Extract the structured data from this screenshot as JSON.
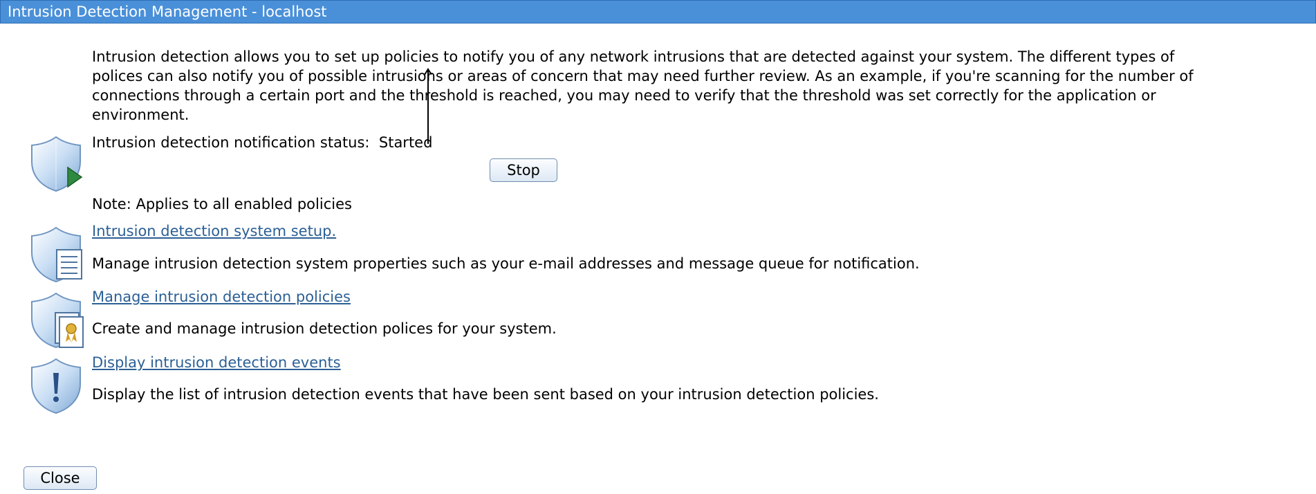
{
  "window": {
    "title": "Intrusion Detection Management - localhost"
  },
  "intro": {
    "lines": [
      "Intrusion detection allows you to set up policies to notify you of any network intrusions that are detected against your system. The different types of",
      "polices can also notify you of possible intrusions or areas of concern that may need further review. As an example, if you're scanning for the number of",
      "connections through a certain port and the threshold is reached, you may need to verify that the threshold was set correctly for the application or",
      "environment."
    ]
  },
  "status": {
    "label": "Intrusion detection notification status:",
    "value": "Started",
    "stop_button": "Stop",
    "note": "Note: Applies to all enabled policies",
    "icon": "shield-play-icon"
  },
  "tasks": [
    {
      "link": "Intrusion detection system setup.",
      "description": "Manage intrusion detection system properties such as your e-mail addresses and message queue for notification.",
      "icon": "shield-list-icon"
    },
    {
      "link": "Manage intrusion detection policies",
      "description": "Create and manage intrusion detection polices for your system.",
      "icon": "shield-certificate-icon"
    },
    {
      "link": "Display intrusion detection events",
      "description": "Display the list of intrusion detection events that have been sent based on your intrusion detection policies.",
      "icon": "shield-exclamation-icon"
    }
  ],
  "footer": {
    "close_button": "Close"
  },
  "colors": {
    "titlebar": "#4a90d9",
    "link": "#2b5f95",
    "shield": "#9fc3e8"
  }
}
